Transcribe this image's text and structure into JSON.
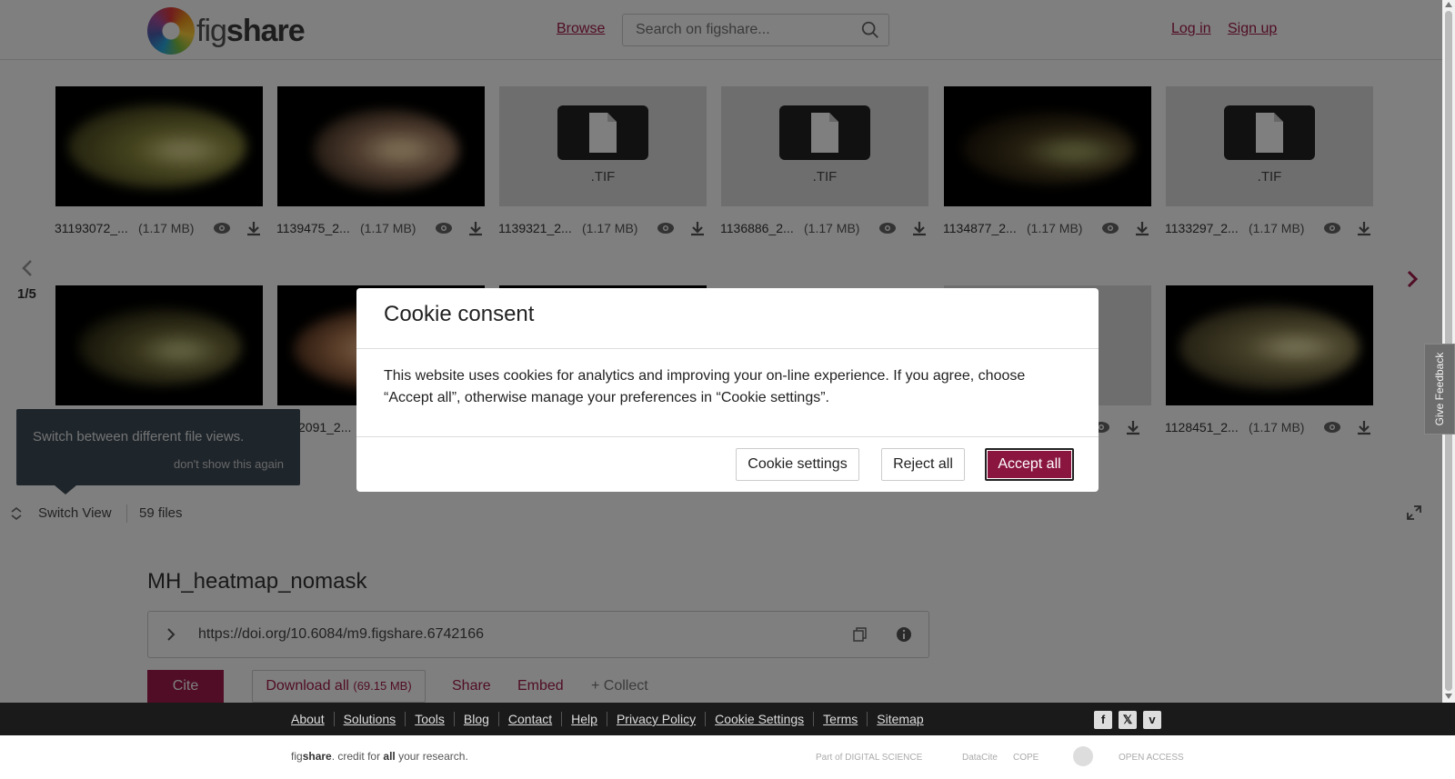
{
  "header": {
    "logo_prefix": "fig",
    "logo_suffix": "share",
    "browse": "Browse",
    "search_placeholder": "Search on figshare...",
    "login": "Log in",
    "signup": "Sign up"
  },
  "files": {
    "row1": [
      {
        "name": "31193072_...",
        "size": "(1.17 MB)",
        "kind": "image",
        "tone": "olive"
      },
      {
        "name": "1139475_2...",
        "size": "(1.17 MB)",
        "kind": "image",
        "tone": "pink"
      },
      {
        "name": "1139321_2...",
        "size": "(1.17 MB)",
        "kind": "tif",
        "ext": ".TIF"
      },
      {
        "name": "1136886_2...",
        "size": "(1.17 MB)",
        "kind": "tif",
        "ext": ".TIF"
      },
      {
        "name": "1134877_2...",
        "size": "(1.17 MB)",
        "kind": "image",
        "tone": "dark"
      },
      {
        "name": "1133297_2...",
        "size": "(1.17 MB)",
        "kind": "tif",
        "ext": ".TIF"
      }
    ],
    "row2_visible": [
      {
        "name": "",
        "kind": "image",
        "tone": "olive"
      },
      {
        "name": "2091_2...",
        "kind": "image",
        "tone": "orange"
      },
      {
        "name": "1128451_2...",
        "size": "(1.17 MB)",
        "kind": "image",
        "tone": "olive"
      }
    ],
    "page": "1/5",
    "switch_view": "Switch View",
    "count": "59 files"
  },
  "tooltip": {
    "text": "Switch between different file views.",
    "dismiss": "don't show this again"
  },
  "item": {
    "title": "MH_heatmap_nomask",
    "doi": "https://doi.org/10.6084/m9.figshare.6742166",
    "cite": "Cite",
    "download": "Download all",
    "download_size": "(69.15 MB)",
    "share": "Share",
    "embed": "Embed",
    "collect": "+ Collect"
  },
  "feedback": "Give Feedback",
  "modal": {
    "title": "Cookie consent",
    "body": "This website uses cookies for analytics and improving your on-line experience. If you agree, choose “Accept all”, otherwise manage your preferences in “Cookie settings”.",
    "settings": "Cookie settings",
    "reject": "Reject all",
    "accept": "Accept all"
  },
  "footer": {
    "links": [
      "About",
      "Solutions",
      "Tools",
      "Blog",
      "Contact",
      "Help",
      "Privacy Policy",
      "Cookie Settings",
      "Terms",
      "Sitemap"
    ],
    "social": [
      "facebook-icon",
      "x-icon",
      "vimeo-icon"
    ],
    "social_glyphs": [
      "f",
      "𝕏",
      "v"
    ],
    "tagline_brand_prefix": "fig",
    "tagline_brand_suffix": "share",
    "tagline_mid": ". credit for ",
    "tagline_bold": "all",
    "tagline_end": " your research.",
    "partners": [
      "Part of DIGITAL SCIENCE",
      "DataCite",
      "COPE",
      "",
      "OPEN ACCESS"
    ]
  },
  "colors": {
    "brand": "#a11a4a",
    "accept_bg": "#8a1640",
    "footer_bg": "#1a1a1a"
  }
}
